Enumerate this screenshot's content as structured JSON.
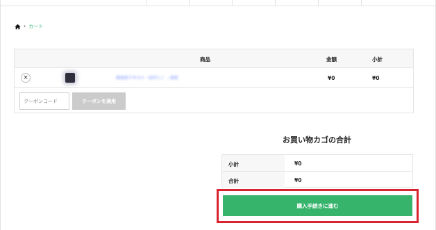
{
  "colors": {
    "accent": "#2bb673",
    "checkout_button": "#37b46c",
    "highlight_border": "#d9232e",
    "coupon_button": "#cbcbcb"
  },
  "breadcrumb": {
    "home_icon": "home-icon",
    "separator": "›",
    "current": "カート"
  },
  "cart_table": {
    "headers": {
      "product": "商品",
      "price": "金額",
      "subtotal": "小計"
    },
    "rows": [
      {
        "remove_label": "×",
        "product_name": "商品名テキスト（ぼかし） - 品名",
        "price": "¥0",
        "subtotal": "¥0"
      }
    ],
    "coupon": {
      "placeholder": "クーポンコード",
      "apply_label": "クーポンを適用"
    }
  },
  "totals": {
    "title": "お買い物カゴの合計",
    "rows": [
      {
        "label": "小計",
        "value": "¥0"
      },
      {
        "label": "合計",
        "value": "¥0"
      }
    ],
    "checkout_label": "購入手続きに進む"
  }
}
